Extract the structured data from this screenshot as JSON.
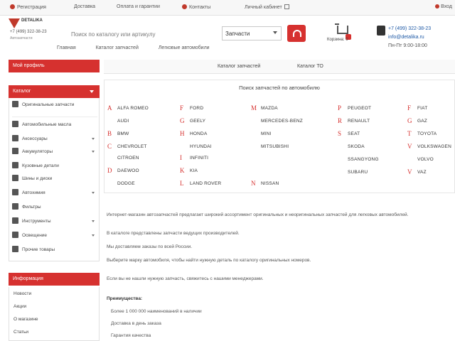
{
  "topbar": {
    "items": [
      "Регистрация",
      "Доставка",
      "Оплата и гарантии",
      "Контакты",
      "Личный кабинет"
    ],
    "login": "Вход"
  },
  "logo": {
    "brand": "DETALIKA",
    "phone": "+7 (499) 322-38-23",
    "sub": "Автозапчасти"
  },
  "search": {
    "label": "Поиск по каталогу или артикулу",
    "value": "Запчасти",
    "cart_text": "Корзина: 0"
  },
  "contacts": {
    "phone": "+7 (499) 322-38-23",
    "email": "info@detalika.ru",
    "hours": "Пн-Пт 9:00-18:00"
  },
  "subnav": [
    "Главная",
    "Каталог запчастей",
    "Легковые автомобили"
  ],
  "sidebar": {
    "profile_label": "Мой профиль",
    "catalog_label": "Каталог",
    "items": [
      "Оригинальные запчасти",
      "Автомобильные масла",
      "Аксессуары",
      "Аккумуляторы",
      "Кузовные детали",
      "Шины и диски",
      "Автохимия",
      "Фильтры",
      "Инструменты",
      "Освещение",
      "Прочие товары"
    ],
    "promo_label": "Информация",
    "promo_items": [
      "Новости",
      "Акции",
      "О магазине",
      "Статьи"
    ]
  },
  "tabs": [
    "Каталог запчастей",
    "Каталог ТО"
  ],
  "catalog": {
    "title": "Поиск запчастей по автомобилю",
    "groups": [
      {
        "letter": "A",
        "brands": [
          "ALFA ROMEO",
          "AUDI"
        ]
      },
      {
        "letter": "B",
        "brands": [
          "BMW"
        ]
      },
      {
        "letter": "C",
        "brands": [
          "CHEVROLET",
          "CITROEN"
        ]
      },
      {
        "letter": "D",
        "brands": [
          "DAEWOO",
          "DODGE"
        ]
      },
      {
        "letter": "F",
        "brands": [
          "FORD"
        ]
      },
      {
        "letter": "G",
        "brands": [
          "GEELY"
        ]
      },
      {
        "letter": "H",
        "brands": [
          "HONDA",
          "HYUNDAI"
        ]
      },
      {
        "letter": "I",
        "brands": [
          "INFINITI"
        ]
      },
      {
        "letter": "K",
        "brands": [
          "KIA"
        ]
      },
      {
        "letter": "L",
        "brands": [
          "LAND ROVER"
        ]
      },
      {
        "letter": "M",
        "brands": [
          "MAZDA",
          "MERCEDES-BENZ",
          "MINI",
          "MITSUBISHI"
        ]
      },
      {
        "letter": "N",
        "brands": [
          "NISSAN"
        ]
      },
      {
        "letter": "P",
        "brands": [
          "PEUGEOT"
        ]
      },
      {
        "letter": "R",
        "brands": [
          "RENAULT"
        ]
      },
      {
        "letter": "S",
        "brands": [
          "SEAT",
          "SKODA",
          "SSANGYONG",
          "SUBARU"
        ]
      },
      {
        "letter": "T",
        "brands": [
          "TOYOTA"
        ]
      },
      {
        "letter": "V",
        "brands": [
          "VOLKSWAGEN",
          "VOLVO"
        ]
      },
      {
        "letter": "F",
        "brands": [
          "FIAT"
        ]
      },
      {
        "letter": "G",
        "brands": [
          "GAZ"
        ]
      },
      {
        "letter": "V",
        "brands": [
          "VAZ"
        ]
      }
    ]
  },
  "paragraphs": [
    "Интернет-магазин автозапчастей предлагает широкий ассортимент оригинальных и неоригинальных запчастей для легковых автомобилей.",
    "В каталоге представлены запчасти ведущих производителей.",
    "Мы доставляем заказы по всей России.",
    "Выберите марку автомобиля, чтобы найти нужную деталь по каталогу оригинальных номеров.",
    "Если вы не нашли нужную запчасть, свяжитесь с нашими менеджерами.",
    "Преимущества:",
    "Более 1 000 000 наименований в наличии",
    "Доставка в день заказа",
    "Гарантия качества"
  ]
}
